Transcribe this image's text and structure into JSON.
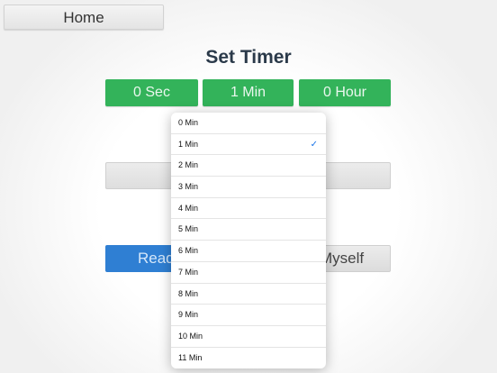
{
  "nav": {
    "home_label": "Home"
  },
  "title": "Set Timer",
  "segments": {
    "sec": "0 Sec",
    "min": "1 Min",
    "hour": "0 Hour"
  },
  "buttons": {
    "read_label": "Read",
    "myself_label": "Myself"
  },
  "picker": {
    "options": [
      "0 Min",
      "1 Min",
      "2 Min",
      "3 Min",
      "4 Min",
      "5 Min",
      "6 Min",
      "7 Min",
      "8 Min",
      "9 Min",
      "10 Min",
      "11 Min"
    ],
    "selected_index": 1,
    "check_glyph": "✓",
    "check_color": "#1a74e8"
  },
  "colors": {
    "green": "#33b35a",
    "blue": "#2f7fd3"
  }
}
